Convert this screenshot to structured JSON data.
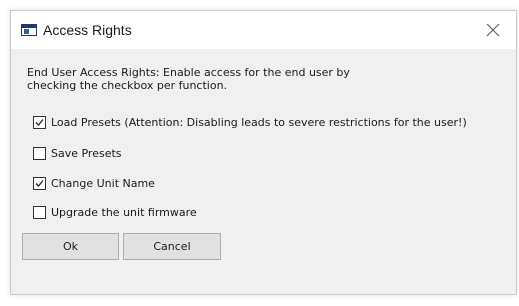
{
  "window": {
    "title": "Access Rights"
  },
  "description": "End User Access Rights: Enable access for the end user by\nchecking the checkbox per function.",
  "options": [
    {
      "label": "Load Presets (Attention: Disabling leads to severe restrictions for the user!)",
      "checked": true
    },
    {
      "label": "Save Presets",
      "checked": false
    },
    {
      "label": "Change Unit Name",
      "checked": true
    },
    {
      "label": "Upgrade the unit firmware",
      "checked": false
    }
  ],
  "buttons": {
    "ok_label": "Ok",
    "cancel_label": "Cancel"
  },
  "icons": {
    "app": "app-window-icon",
    "close": "close-icon",
    "check": "checkmark-icon"
  },
  "colors": {
    "dialog_bg": "#f0f0f0",
    "titlebar_bg": "#ffffff",
    "button_bg": "#e1e1e1",
    "icon_accent": "#1f3b6e"
  }
}
